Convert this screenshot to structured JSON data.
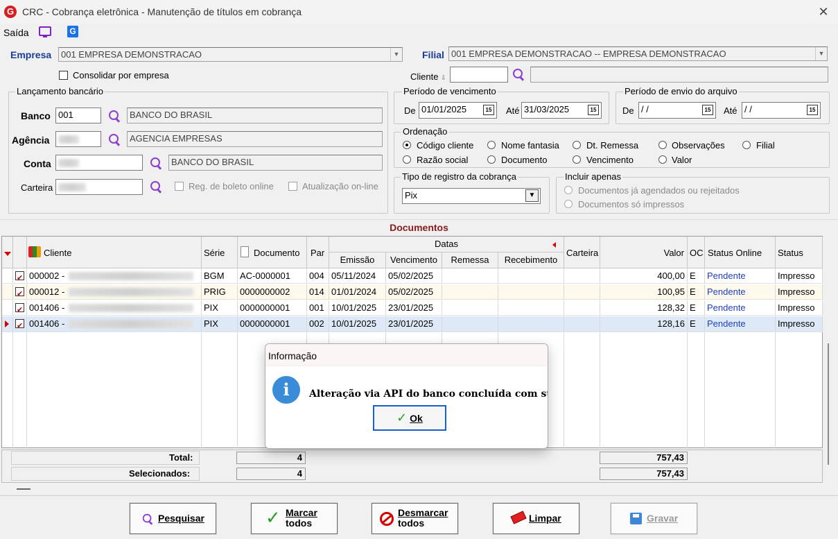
{
  "window": {
    "title": "CRC - Cobrança eletrônica - Manutenção de títulos em cobrança",
    "close": "✕",
    "logo": "G"
  },
  "menu": {
    "saida": "Saída",
    "icons": [
      "monitor-icon",
      "g-icon"
    ]
  },
  "empresa": {
    "label": "Empresa",
    "value": "001 EMPRESA DEMONSTRACAO"
  },
  "filial": {
    "label": "Filial",
    "value": "001 EMPRESA DEMONSTRACAO -- EMPRESA DEMONSTRACAO"
  },
  "consolidar": {
    "label": "Consolidar por empresa",
    "checked": false
  },
  "cliente": {
    "label": "Cliente",
    "value": "",
    "name": ""
  },
  "lancamento": {
    "title": "Lançamento bancário",
    "banco": {
      "label": "Banco",
      "code": "001",
      "name": "BANCO DO BRASIL"
    },
    "agencia": {
      "label": "Agência",
      "code": "",
      "name": "AGENCIA EMPRESAS"
    },
    "conta": {
      "label": "Conta",
      "code": "",
      "name": "BANCO DO BRASIL"
    },
    "carteira": {
      "label": "Carteira",
      "code": ""
    },
    "reg_boleto": "Reg. de boleto online",
    "atualizacao": "Atualização on-line"
  },
  "vencimento": {
    "title": "Período de vencimento",
    "de_label": "De",
    "de": "01/01/2025",
    "ate_label": "Até",
    "ate": "31/03/2025"
  },
  "envio": {
    "title": "Período de envio do arquivo",
    "de_label": "De",
    "de": " / /",
    "ate_label": "Até",
    "ate": " / /"
  },
  "calendar_glyph": "15",
  "ordenacao": {
    "title": "Ordenação",
    "options": [
      "Código cliente",
      "Nome fantasia",
      "Dt. Remessa",
      "Observações",
      "Filial",
      "Razão social",
      "Documento",
      "Vencimento",
      "Valor"
    ],
    "selected": "Código cliente"
  },
  "tipo_registro": {
    "title": "Tipo de registro da cobrança",
    "value": "Pix"
  },
  "incluir": {
    "title": "Incluir apenas",
    "options": [
      "Documentos já agendados ou rejeitados",
      "Documentos só impressos"
    ]
  },
  "documentos": {
    "title": "Documentos",
    "headers": {
      "cliente": "Cliente",
      "serie": "Série",
      "documento": "Documento",
      "par": "Par",
      "datas": "Datas",
      "emissao": "Emissão",
      "vencimento": "Vencimento",
      "remessa": "Remessa",
      "recebimento": "Recebimento",
      "carteira": "Carteira",
      "valor": "Valor",
      "oc": "OC",
      "status_online": "Status Online",
      "status": "Status"
    },
    "rows": [
      {
        "cliente": "000002 -",
        "serie": "BGM",
        "documento": "AC-0000001",
        "par": "004",
        "emissao": "05/11/2024",
        "vencimento": "05/02/2025",
        "remessa": "",
        "recebimento": "",
        "carteira": "",
        "valor": "400,00",
        "oc": "E",
        "status_online": "Pendente",
        "status": "Impresso"
      },
      {
        "cliente": "000012 -",
        "serie": "PRIG",
        "documento": "0000000002",
        "par": "014",
        "emissao": "01/01/2024",
        "vencimento": "05/02/2025",
        "remessa": "",
        "recebimento": "",
        "carteira": "",
        "valor": "100,95",
        "oc": "E",
        "status_online": "Pendente",
        "status": "Impresso"
      },
      {
        "cliente": "001406 -",
        "serie": "PIX",
        "documento": "0000000001",
        "par": "001",
        "emissao": "10/01/2025",
        "vencimento": "23/01/2025",
        "remessa": "",
        "recebimento": "",
        "carteira": "",
        "valor": "128,32",
        "oc": "E",
        "status_online": "Pendente",
        "status": "Impresso"
      },
      {
        "cliente": "001406 -",
        "serie": "PIX",
        "documento": "0000000001",
        "par": "002",
        "emissao": "10/01/2025",
        "vencimento": "23/01/2025",
        "remessa": "",
        "recebimento": "",
        "carteira": "",
        "valor": "128,16",
        "oc": "E",
        "status_online": "Pendente",
        "status": "Impresso"
      }
    ],
    "total_label": "Total:",
    "total_count": "4",
    "total_value": "757,43",
    "sel_label": "Selecionados:",
    "sel_count": "4",
    "sel_value": "757,43"
  },
  "buttons": {
    "pesquisar": "Pesquisar",
    "marcar_1": "Marcar",
    "marcar_2": "todos",
    "desmarcar_1": "Desmarcar",
    "desmarcar_2": "todos",
    "limpar": "Limpar",
    "gravar": "Gravar"
  },
  "dialog": {
    "title": "Informação",
    "message": "Alteração via API do banco concluída com sucesso!",
    "ok": "Ok",
    "icon": "i"
  },
  "colors": {
    "accent": "#8a3fd0",
    "label_blue": "#1b3c94",
    "status_blue": "#1f3fbf",
    "section_red": "#8b1a1a"
  }
}
